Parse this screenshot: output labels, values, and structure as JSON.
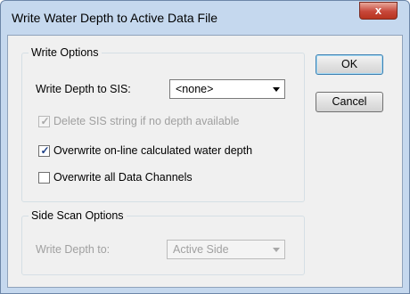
{
  "window": {
    "title": "Write Water Depth to Active Data File",
    "close_label": "x"
  },
  "write_options": {
    "legend": "Write Options",
    "write_depth_label": "Write Depth to SIS:",
    "write_depth_value": "<none>",
    "delete_sis_label": "Delete SIS string if no depth available",
    "delete_sis_checked": true,
    "overwrite_online_label": "Overwrite on-line calculated water depth",
    "overwrite_online_checked": true,
    "overwrite_all_label": "Overwrite all Data Channels",
    "overwrite_all_checked": false
  },
  "side_scan_options": {
    "legend": "Side Scan Options",
    "write_depth_label": "Write Depth to:",
    "write_depth_value": "Active Side"
  },
  "buttons": {
    "ok": "OK",
    "cancel": "Cancel"
  },
  "check_glyph": "✓"
}
